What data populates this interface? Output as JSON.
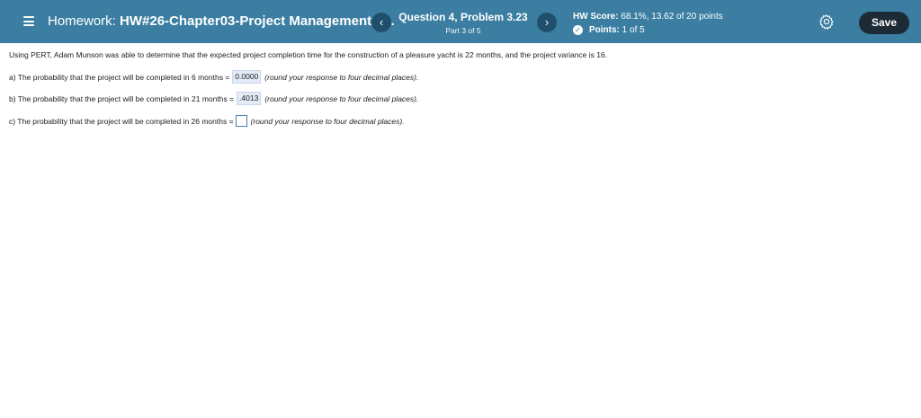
{
  "header": {
    "homework_prefix": "Homework:",
    "homework_name": "HW#26-Chapter03-Project Management-P...",
    "question_title": "Question 4, Problem 3.23",
    "question_part": "Part 3 of 5",
    "prev_symbol": "‹",
    "next_symbol": "›",
    "hw_score_label": "HW Score:",
    "hw_score_value": "68.1%, 13.62 of 20 points",
    "points_label": "Points:",
    "points_value": "1 of 5",
    "save_label": "Save"
  },
  "problem": {
    "intro": "Using PERT, Adam Munson was able to determine that the expected project completion time for the construction of a pleasure yacht is 22 months, and the project variance is 16.",
    "parts": [
      {
        "text": "a) The probability that the project will be completed in 6 months =",
        "answer": "0.0000",
        "hint": "(round your response to four decimal places)."
      },
      {
        "text": "b) The probability that the project will be completed in 21 months =",
        "answer": ".4013",
        "hint": "(round your response to four decimal places)."
      },
      {
        "text": "c) The probability that the project will be completed in 26 months =",
        "answer": "",
        "hint": "(round your response to four decimal places)."
      }
    ]
  },
  "colors": {
    "topbar": "#3b7ea1",
    "save_button": "#1c2b36",
    "nav_button": "#1f4f6b",
    "answer_highlight": "#e3ebf7"
  }
}
